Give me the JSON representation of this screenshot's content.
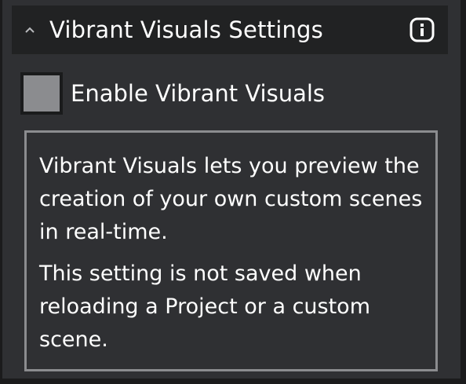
{
  "panel": {
    "title": "Vibrant Visuals Settings",
    "icons": {
      "collapse": "chevron-up-icon",
      "info": "info-icon"
    },
    "colors": {
      "panel_bg": "#2f3033",
      "header_bg": "#212223",
      "checkbox_fill": "#8b8c8f",
      "border": "#8b8c8f",
      "text": "#ffffff"
    }
  },
  "checkbox": {
    "label": "Enable Vibrant Visuals",
    "checked": false
  },
  "info_box": {
    "paragraphs": [
      "Vibrant Visuals lets you preview the creation of your own custom scenes in real-time.",
      "This setting is not saved when reloading a Project or a custom scene."
    ]
  }
}
